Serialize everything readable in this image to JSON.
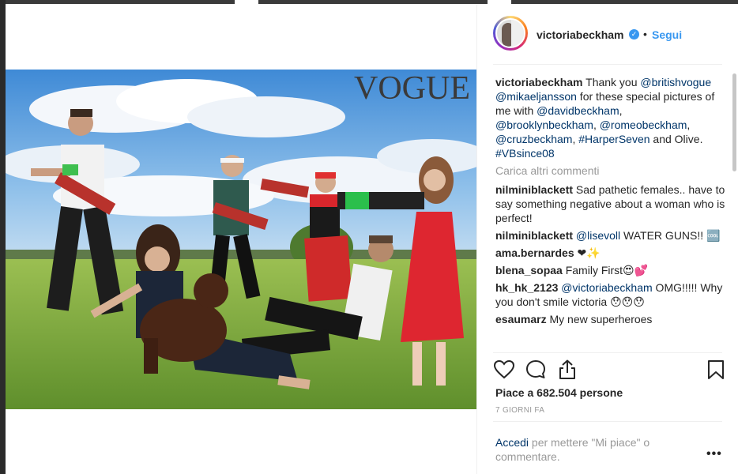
{
  "photo": {
    "magazine": "VOGUE"
  },
  "header": {
    "username": "victoriabeckham",
    "separator": "•",
    "follow_label": "Segui",
    "verified_glyph": "✓"
  },
  "caption": {
    "username": "victoriabeckham",
    "text_1": " Thank you ",
    "mention_1": "@britishvogue",
    "text_2": " ",
    "mention_2": "@mikaeljansson",
    "text_3": " for these special pictures of me with ",
    "mention_3": "@davidbeckham",
    "text_4": ", ",
    "mention_4": "@brooklynbeckham",
    "text_5": ", ",
    "mention_5": "@romeobeckham",
    "text_6": ", ",
    "mention_6": "@cruzbeckham",
    "text_7": ", ",
    "hashtag_1": "#HarperSeven",
    "text_8": " and Olive. ",
    "hashtag_2": "#VBsince08"
  },
  "load_more": "Carica altri commenti",
  "comments": [
    {
      "username": "nilminiblackett",
      "text": " Sad pathetic females.. have to say something negative about a woman who is perfect!"
    },
    {
      "username": "nilminiblackett",
      "mention": "@lisevoll",
      "text": " WATER GUNS!! 🆒"
    },
    {
      "username": "ama.bernardes",
      "text": " ❤✨"
    },
    {
      "username": "blena_sopaa",
      "text": " Family First😍💕"
    },
    {
      "username": "hk_hk_2123",
      "mention": "@victoriabeckham",
      "text": " OMG!!!!! Why you don't smile victoria 😯😯😯"
    },
    {
      "username": "esaumarz",
      "text": " My new superheroes"
    }
  ],
  "icons": {
    "like": "heart-icon",
    "comment": "comment-bubble-icon",
    "share": "share-icon",
    "save": "bookmark-icon",
    "more": "more-options-icon"
  },
  "likes_text": "Piace a 682.504 persone",
  "date_text": "7 GIORNI FA",
  "login": {
    "link": "Accedi",
    "text": " per mettere \"Mi piace\" o commentare."
  },
  "more_glyph": "•••",
  "colors": {
    "accent": "#3897f0",
    "link": "#003569",
    "muted": "#999999"
  }
}
